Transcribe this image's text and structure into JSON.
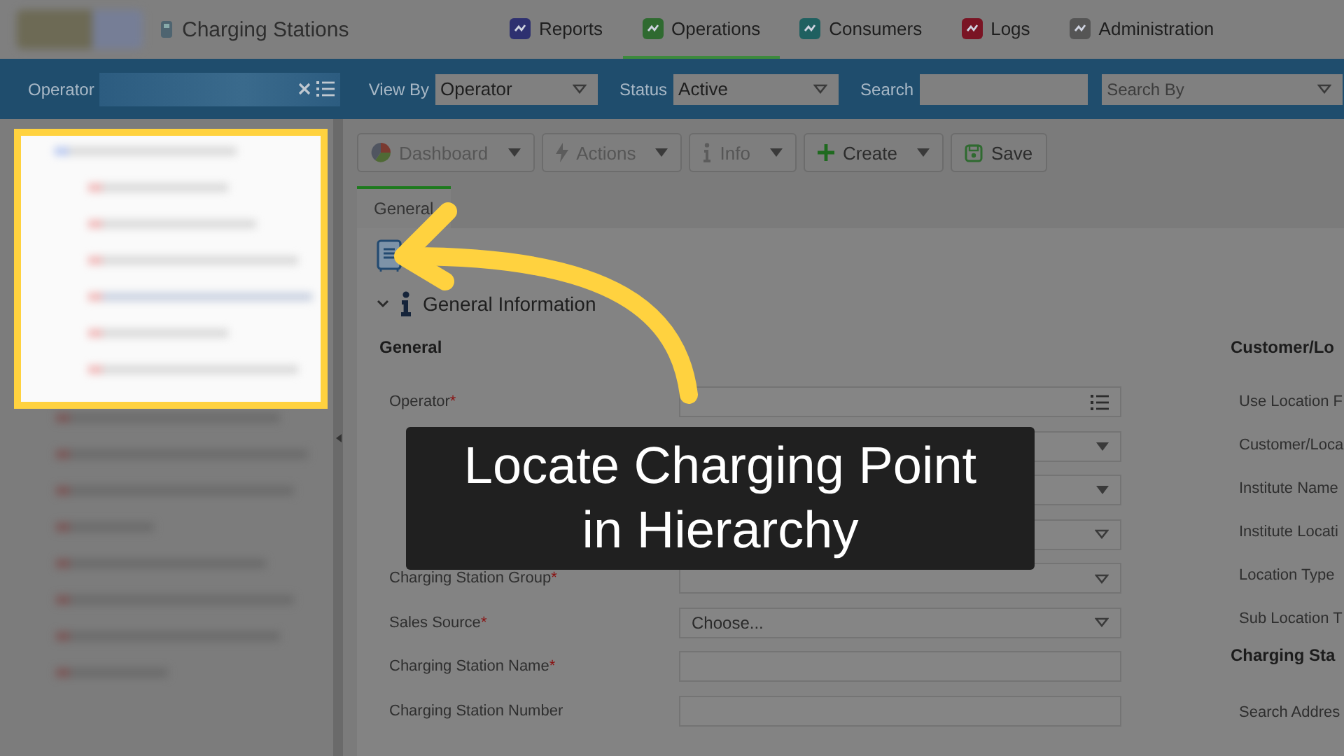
{
  "header": {
    "app_title": "Charging Stations",
    "nav": [
      {
        "label": "Reports",
        "selected": false,
        "color": "#2e3070"
      },
      {
        "label": "Operations",
        "selected": true,
        "color": "#2f6a30"
      },
      {
        "label": "Consumers",
        "selected": false,
        "color": "#1f6060"
      },
      {
        "label": "Logs",
        "selected": false,
        "color": "#7a1424"
      },
      {
        "label": "Administration",
        "selected": false,
        "color": "#555555"
      }
    ]
  },
  "filter_bar": {
    "operator_label": "Operator",
    "view_by_label": "View By",
    "view_by_value": "Operator",
    "status_label": "Status",
    "status_value": "Active",
    "search_label": "Search",
    "search_by_placeholder": "Search By"
  },
  "toolbar": [
    {
      "label": "Dashboard",
      "kind": "pie",
      "dropdown": true,
      "disabled": true
    },
    {
      "label": "Actions",
      "kind": "bolt",
      "dropdown": true,
      "disabled": true
    },
    {
      "label": "Info",
      "kind": "info",
      "dropdown": true,
      "disabled": true
    },
    {
      "label": "Create",
      "kind": "plus",
      "dropdown": true,
      "disabled": false
    },
    {
      "label": "Save",
      "kind": "disk",
      "dropdown": false,
      "disabled": false
    }
  ],
  "tabs": [
    {
      "label": "General",
      "selected": true
    }
  ],
  "section": {
    "title": "General Information",
    "expanded": true
  },
  "general": {
    "heading": "General",
    "rows": [
      {
        "label": "Operator",
        "required_mark": "*",
        "kind": "lookup"
      },
      {
        "kind": "combo"
      },
      {
        "kind": "combo"
      },
      {
        "kind": "select"
      },
      {
        "label": "Charging Station Group",
        "required_mark": "*",
        "kind": "select"
      },
      {
        "label": "Sales Source",
        "required_mark": "*",
        "kind": "select",
        "value": "Choose..."
      },
      {
        "label": "Charging Station Name",
        "required_mark": "*",
        "kind": "text"
      },
      {
        "label": "Charging Station Number",
        "kind": "text"
      }
    ]
  },
  "customer": {
    "heading": "Customer/Lo",
    "labels": [
      "Use Location F",
      "Customer/Loca",
      "Institute Name",
      "Institute Locati",
      "Location Type",
      "Sub Location T"
    ]
  },
  "station": {
    "heading": "Charging Sta",
    "labels": [
      "Search Addres"
    ]
  },
  "tutorial": {
    "caption": "Locate Charging Point in Hierarchy"
  }
}
